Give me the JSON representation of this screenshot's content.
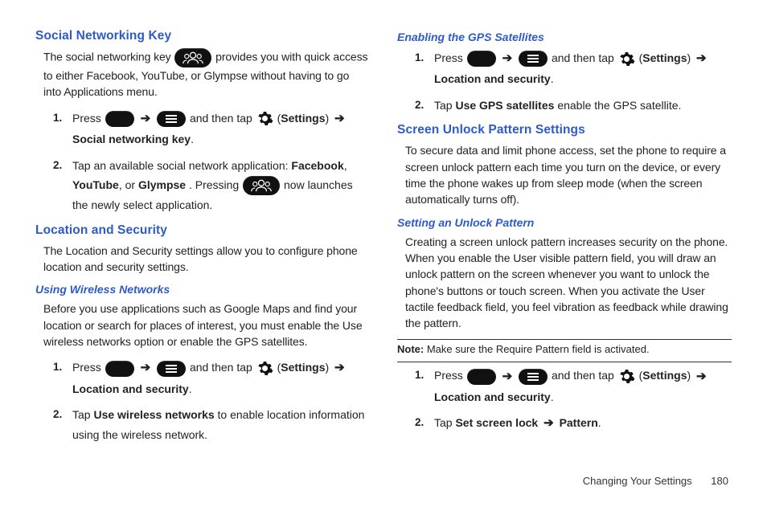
{
  "left": {
    "section_social_title": "Social Networking Key",
    "social_intro_a": "The social networking key ",
    "social_intro_b": " provides you with quick access to either Facebook, YouTube, or Glympse without having to go into Applications menu.",
    "social_step1_a": "Press ",
    "social_step1_b": " and then tap ",
    "social_step1_c": " (",
    "social_step1_d": ") ",
    "social_step1_bold_settings": "Settings",
    "social_step1_bold_item": "Social networking key",
    "social_step1_end": ".",
    "social_step2_a": "Tap an available social network application: ",
    "social_step2_b1": "Facebook",
    "social_step2_b2": "YouTube",
    "social_step2_b3": "Glympse",
    "social_step2_c": ". Pressing ",
    "social_step2_d": " now launches the newly select application.",
    "section_location_title": "Location and Security",
    "location_intro": "The Location and Security settings allow you to configure phone location and security settings.",
    "sub_wireless_title": "Using Wireless Networks",
    "wireless_intro": "Before you use applications such as Google Maps and find your location or search for places of interest, you must enable the Use wireless networks option or enable the GPS satellites.",
    "wireless_step1_bold_item": "Location and security",
    "wireless_step2_a": "Tap ",
    "wireless_step2_bold": "Use wireless networks",
    "wireless_step2_b": " to enable location information using the wireless network."
  },
  "right": {
    "sub_gps_title": "Enabling the GPS Satellites",
    "gps_step1_bold_item": "Location and security",
    "gps_step2_a": "Tap ",
    "gps_step2_bold": "Use GPS satellites",
    "gps_step2_b": " enable the GPS satellite.",
    "section_screen_title": "Screen Unlock Pattern Settings",
    "screen_intro": "To secure data and limit phone access, set the phone to require a screen unlock pattern each time you turn on the device, or every time the phone wakes up from sleep mode (when the screen automatically turns off).",
    "sub_pattern_title": "Setting an Unlock Pattern",
    "pattern_intro": "Creating a screen unlock pattern increases security on the phone. When you enable the User visible pattern field, you will draw an unlock pattern on the screen whenever you want to unlock the phone's buttons or touch screen. When you activate the User tactile feedback field, you feel vibration as feedback while drawing the pattern.",
    "note_label": "Note:",
    "note_text": " Make sure the Require Pattern field is activated.",
    "pattern_step1_bold_item": "Location and security",
    "pattern_step2_a": "Tap ",
    "pattern_step2_bold1": "Set screen lock",
    "pattern_step2_bold2": "Pattern",
    "pattern_step2_end": "."
  },
  "shared": {
    "press": "Press ",
    "then_tap": " and then tap ",
    "open_paren": " (",
    "close_paren_arrow": ") ",
    "settings": "Settings",
    "arrow": "➔",
    "sep_comma": ", ",
    "sep_or": ", or "
  },
  "footer": {
    "chapter": "Changing Your Settings",
    "page": "180"
  }
}
